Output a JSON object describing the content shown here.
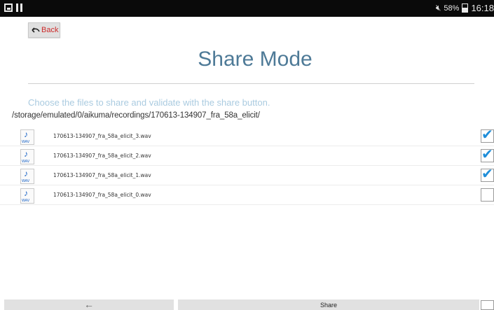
{
  "status_bar": {
    "battery_percent": "58%",
    "time": "16:18",
    "battery_level": 0.58
  },
  "back_label": "Back",
  "title": "Share Mode",
  "instructions": "Choose the files to share and validate with the share button.",
  "path": "/storage/emulated/0/aikuma/recordings/170613-134907_fra_58a_elicit/",
  "files": [
    {
      "name": "170613-134907_fra_58a_elicit_3.wav",
      "type": "WAV",
      "checked": true
    },
    {
      "name": "170613-134907_fra_58a_elicit_2.wav",
      "type": "WAV",
      "checked": true
    },
    {
      "name": "170613-134907_fra_58a_elicit_1.wav",
      "type": "WAV",
      "checked": true
    },
    {
      "name": "170613-134907_fra_58a_elicit_0.wav",
      "type": "WAV",
      "checked": false
    }
  ],
  "bottom": {
    "prev_label": "←",
    "share_label": "Share",
    "select_all_checked": false
  },
  "colors": {
    "title": "#4e7a97",
    "instructions": "#aacbe0",
    "back_text": "#cc2a2a",
    "check": "#1f8ed9"
  }
}
